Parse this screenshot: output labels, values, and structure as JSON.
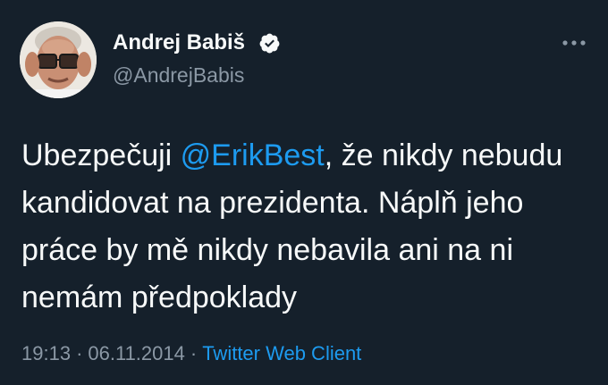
{
  "author": {
    "display_name": "Andrej Babiš",
    "handle": "@AndrejBabis",
    "verified": true,
    "avatar_icon": "profile-photo"
  },
  "tweet": {
    "lines": [
      {
        "before": "Ubezpečuji ",
        "mention": "@ErikBest",
        "after": ", že nikdy nebudu"
      },
      {
        "text": "kandidovat na prezidenta. Náplň jeho"
      },
      {
        "text": "práce by mě nikdy nebavila ani na ni"
      },
      {
        "text": "nemám předpoklady"
      }
    ]
  },
  "meta": {
    "time": "19:13",
    "separator": "·",
    "date": "06.11.2014",
    "client": "Twitter Web Client"
  },
  "icons": {
    "more": "more-horizontal-icon",
    "verified": "verified-badge-icon"
  },
  "colors": {
    "background": "#15202b",
    "text": "#f7f9f9",
    "secondary": "#8b98a5",
    "accent": "#1d9bf0"
  }
}
